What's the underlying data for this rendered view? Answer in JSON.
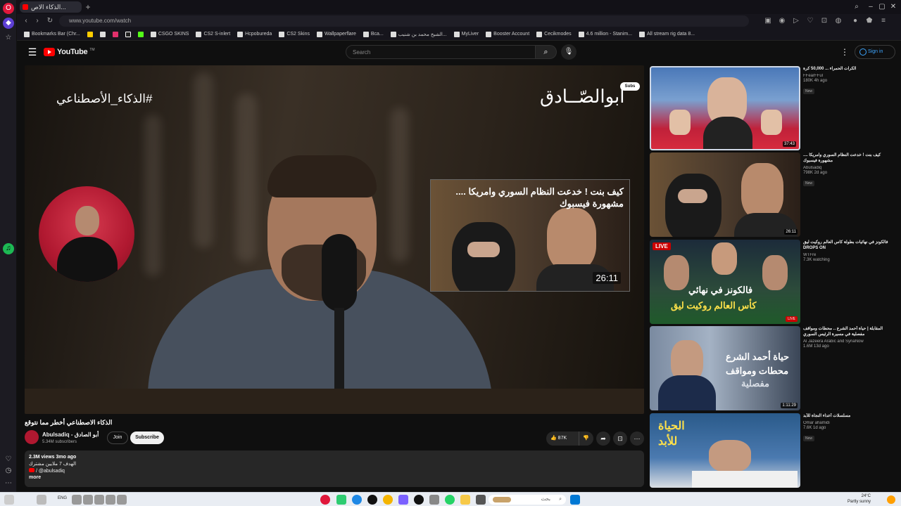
{
  "browser": {
    "tab_title": "الذكاء الاص...",
    "url": "www.youtube.com/watch",
    "bookmarks": [
      "Bookmarks Bar (Chr...",
      "CSGO SKINS",
      "CS2 S-inlert",
      "Hcpobureda",
      "CS2 Skins",
      "Wallpaperflare",
      "Bca...",
      "الشيخ محمد بن شنيب...",
      "MyLiver",
      "Booster Account",
      "Cecikmodes",
      "4.6 million - Stanim...",
      "All stream rig data 8..."
    ]
  },
  "header": {
    "logo_text": "YouTube",
    "logo_suffix": "TM",
    "search_placeholder": "Search",
    "signin_label": "Sign in"
  },
  "video": {
    "overlay_hashtag": "#الذكاء_الأصطناعي",
    "watermark": "أبوالصّــادق",
    "badge": "Subs",
    "endcard_title": "كيف بنت ! خدعت النظام السوري وامريكا .... مشهورة فيسبوك",
    "endcard_duration": "26:11",
    "title": "الذكاء الاصطناعي أخطر مما نتوقع",
    "channel_name": "Abulsadiq - أبو الصادق",
    "channel_subs": "5.34M subscribers",
    "join_label": "Join",
    "subscribe_label": "Subscribe",
    "likes": "87K",
    "views_date": "2.3M views  3mo ago",
    "desc_line1": "الهدف 7 ملايين مشترك",
    "desc_line2": "/ @abulsadiq",
    "more_label": "more"
  },
  "recommendations": [
    {
      "title": "الكرات الحمراء ... 50,000 كرة",
      "channel": "FFearFFul",
      "stats": "180K  4h ago",
      "badge": "New",
      "duration": "37:43"
    },
    {
      "title": "كيف بنت ! خدعت النظام السوري وامريكا .... مشهورة فيسبوك",
      "channel": "Abulsadiq",
      "stats": "798K  2d ago",
      "badge": "New",
      "duration": "26:11"
    },
    {
      "title": "فالكونز في نهائيات بطولة كاس العالم روكيت ليق DROPS ON",
      "channel": "WTFre",
      "stats": "7.3K watching",
      "badge": "",
      "duration": "LIVE"
    },
    {
      "title": "المقابلة | حياة أحمد الشرع .. محطات ومواقف مفصلية في مسيرة الرئيس السوري",
      "channel": "Al Jazeera Arabic and SyriaNow",
      "stats": "1.6M  13d ago",
      "badge": "",
      "duration": "1:11:29"
    },
    {
      "title": "مسلسلات أعداء النجاة للأبد",
      "channel": "Omar ahamidi",
      "stats": "7.6K  1d ago",
      "badge": "New",
      "duration": ""
    }
  ],
  "thumb_texts": {
    "rec3_line1": "فالكونز في نهائي",
    "rec3_line2": "كأس العالم روكيت ليق",
    "rec4_line1": "حياة أحمد الشرع",
    "rec4_line2": "محطات ومواقف",
    "rec4_line3": "مفصلية",
    "rec5_line1": "الحياة",
    "rec5_line2": "للأبد",
    "live": "LIVE"
  },
  "taskbar": {
    "lang": "ENG",
    "search_text": "بحث",
    "weather_temp": "24°C",
    "weather_desc": "Partly sunny"
  },
  "colors": {
    "accent": "#ff0000",
    "link": "#3ea6ff",
    "background": "#0f0f0f"
  }
}
